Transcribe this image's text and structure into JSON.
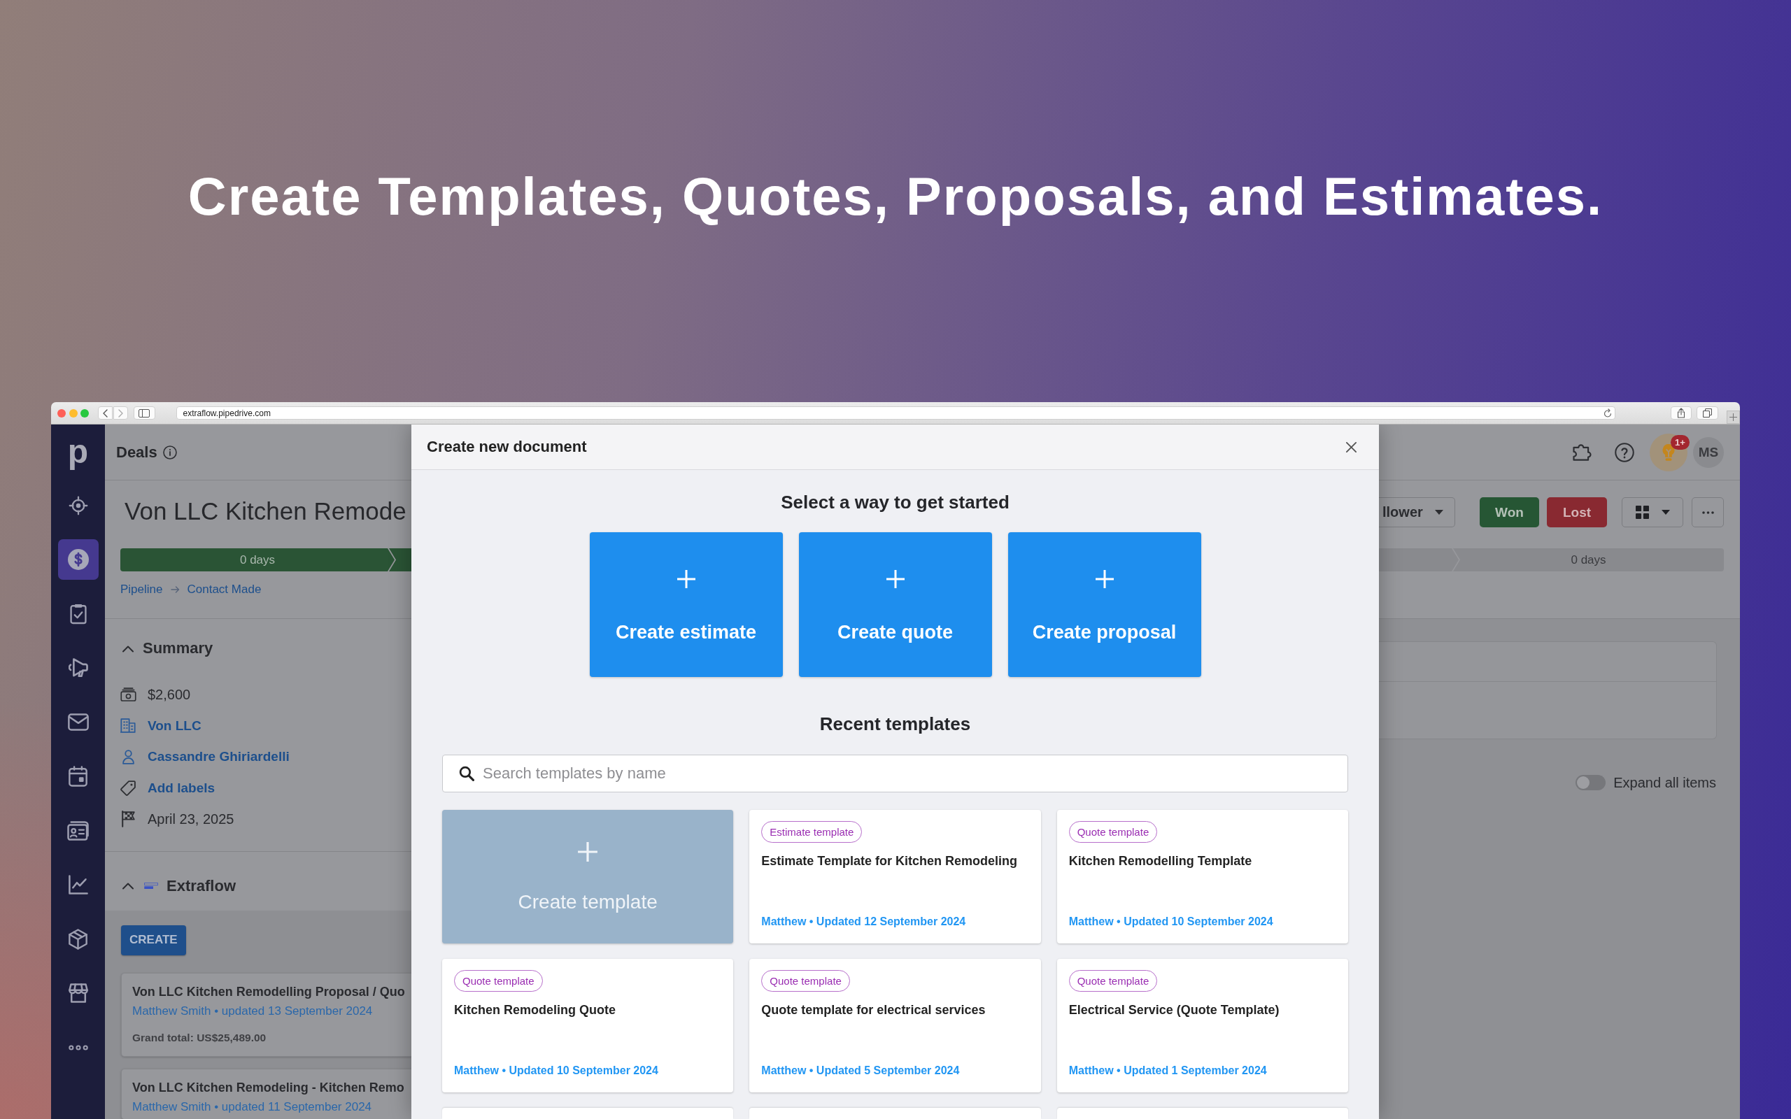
{
  "headline": "Create Templates, Quotes, Proposals, and Estimates.",
  "browser": {
    "url": "extraflow.pipedrive.com"
  },
  "nav": {
    "logo": "p",
    "items": [
      {
        "kind": "target",
        "selected": false
      },
      {
        "kind": "deals",
        "selected": true
      },
      {
        "kind": "tasks",
        "selected": false
      },
      {
        "kind": "campaigns",
        "selected": false
      },
      {
        "kind": "mail",
        "selected": false
      },
      {
        "kind": "calendar",
        "selected": false
      },
      {
        "kind": "contacts",
        "selected": false
      },
      {
        "kind": "insights",
        "selected": false
      },
      {
        "kind": "products",
        "selected": false
      },
      {
        "kind": "marketplace",
        "selected": false
      },
      {
        "kind": "more",
        "selected": false
      }
    ]
  },
  "topbar": {
    "title": "Deals",
    "notification_badge": "1+",
    "avatar_initials": "MS"
  },
  "deal": {
    "title": "Von LLC Kitchen Remode",
    "follower_button": "llower",
    "outcome_buttons": [
      {
        "kind": "won",
        "label": "Won"
      },
      {
        "kind": "lost",
        "label": "Lost"
      }
    ],
    "stages_left": [
      {
        "label": "0 days",
        "reached": true
      },
      {
        "reached": true
      }
    ],
    "stages_right": [
      {
        "reached": false
      },
      {
        "label": "0 days",
        "reached": false
      }
    ],
    "breadcrumb": [
      "Pipeline",
      "Contact Made"
    ]
  },
  "summary": {
    "title": "Summary",
    "expanded": true,
    "items": [
      {
        "kind": "value",
        "text": "$2,600",
        "link": false
      },
      {
        "kind": "organization",
        "text": "Von LLC",
        "link": true
      },
      {
        "kind": "person",
        "text": "Cassandre Ghiriardelli",
        "link": true
      },
      {
        "kind": "labels",
        "text": "Add labels",
        "link": true
      },
      {
        "kind": "close_date",
        "text": "April 23, 2025",
        "link": false
      }
    ]
  },
  "extraflow": {
    "title": "Extraflow",
    "expanded": true,
    "create_button": "CREATE",
    "documents": [
      {
        "title": "Von LLC Kitchen Remodelling Proposal / Quo",
        "meta": "Matthew Smith • updated 13 September 2024",
        "total": "Grand total: US$25,489.00"
      },
      {
        "title": "Von LLC Kitchen Remodeling - Kitchen Remo",
        "meta": "Matthew Smith • updated 11 September 2024"
      }
    ]
  },
  "expand_all": {
    "label": "Expand all items",
    "on": false
  },
  "modal": {
    "title": "Create new document",
    "intro": "Select a way to get started",
    "create_options": [
      "Create estimate",
      "Create quote",
      "Create proposal"
    ],
    "recent_title": "Recent templates",
    "search": {
      "placeholder": "Search templates by name"
    },
    "templates": [
      {
        "kind": "create",
        "label": "Create template"
      },
      {
        "kind": "template",
        "tag": "Estimate template",
        "title": "Estimate Template for Kitchen Remodeling",
        "meta": "Matthew • Updated 12 September 2024"
      },
      {
        "kind": "template",
        "tag": "Quote template",
        "title": "Kitchen Remodelling Template",
        "meta": "Matthew • Updated 10 September 2024"
      },
      {
        "kind": "template",
        "tag": "Quote template",
        "title": "Kitchen Remodeling Quote",
        "meta": "Matthew • Updated 10 September 2024"
      },
      {
        "kind": "template",
        "tag": "Quote template",
        "title": "Quote template for electrical services",
        "meta": "Matthew • Updated 5 September 2024"
      },
      {
        "kind": "template",
        "tag": "Quote template",
        "title": "Electrical Service (Quote Template)",
        "meta": "Matthew • Updated 1 September 2024"
      },
      {
        "kind": "cut_off"
      },
      {
        "kind": "cut_off"
      },
      {
        "kind": "cut_off"
      }
    ]
  }
}
